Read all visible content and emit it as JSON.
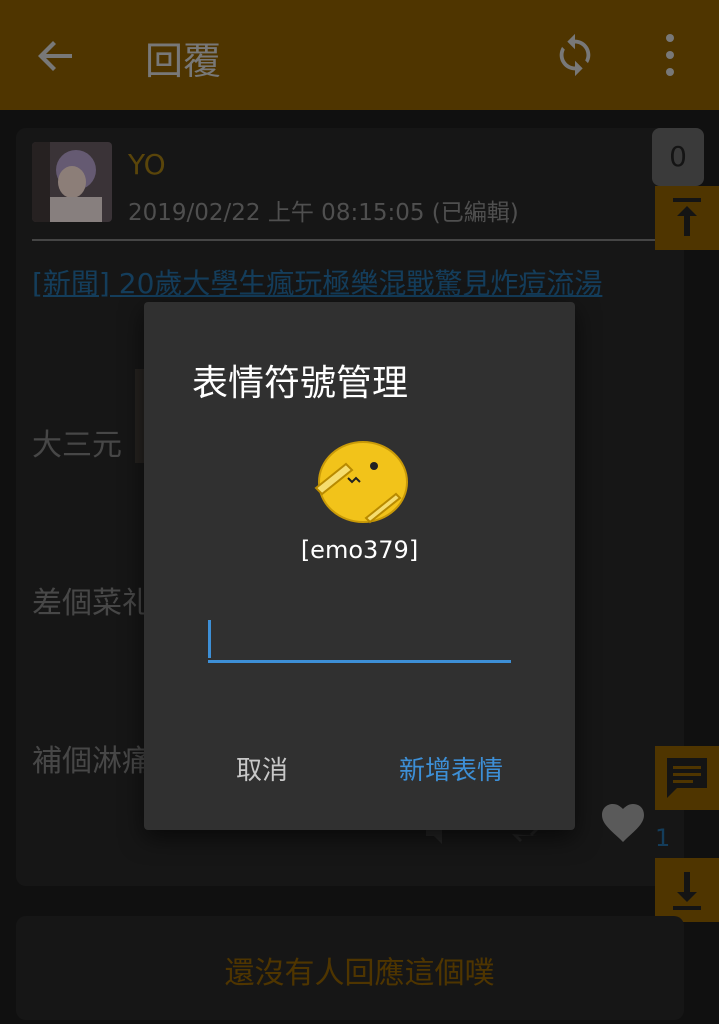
{
  "topbar": {
    "title": "回覆",
    "back_icon": "arrow-left-icon",
    "refresh_icon": "refresh-icon",
    "more_icon": "more-vertical-icon",
    "bg_color": "#7a5200"
  },
  "post": {
    "author": "YO",
    "timestamp": "2019/02/22 上午 08:15:05 (已編輯)",
    "link_text": "[新聞] 20歲大學生瘋玩極樂混戰驚見炸痘流湯",
    "lines": [
      "大三元",
      "差個菜礼",
      "補個淋痛"
    ],
    "reply_count": "0",
    "like_count": "1"
  },
  "sidebar": {
    "scroll_top_icon": "arrow-up-to-top-icon",
    "comment_icon": "comment-icon",
    "scroll_bottom_icon": "arrow-down-to-bottom-icon"
  },
  "actions": {
    "mute_icon": "mute-icon",
    "replurk_icon": "replurk-icon",
    "like_icon": "heart-icon"
  },
  "reply_prompt": "還沒有人回應這個噗",
  "dialog": {
    "title": "表情符號管理",
    "emoticon_code": "[emo379]",
    "input_value": "",
    "input_placeholder": "",
    "cancel_label": "取消",
    "add_label": "新增表情",
    "accent_color": "#3d8fd6"
  }
}
